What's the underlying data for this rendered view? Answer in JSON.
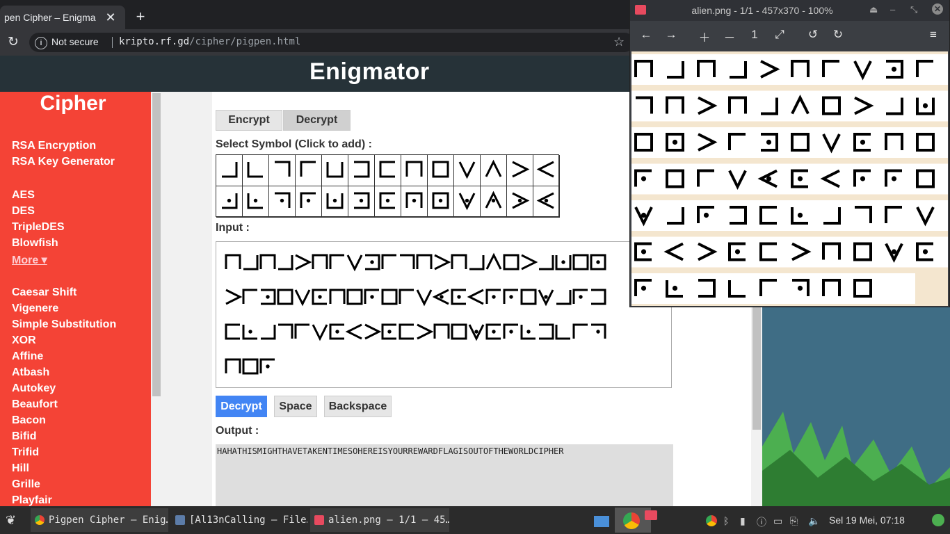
{
  "browser": {
    "tab_title": "pen Cipher – Enigma",
    "new_tab": "+",
    "close_glyph": "✕",
    "reload_glyph": "↻",
    "not_secure": "Not secure",
    "url_host": "kripto.rf.gd",
    "url_path": "/cipher/pigpen.html",
    "star_glyph": "☆"
  },
  "site": {
    "title": "Enigmator"
  },
  "sidebar": {
    "title": "Cipher",
    "items": [
      "RSA Encryption",
      "RSA Key Generator",
      "AES",
      "DES",
      "TripleDES",
      "Blowfish",
      "More ▾",
      "Caesar Shift",
      "Vigenere",
      "Simple Substitution",
      "XOR",
      "Affine",
      "Atbash",
      "Autokey",
      "Beaufort",
      "Bacon",
      "Bifid",
      "Trifid",
      "Hill",
      "Grille",
      "Playfair"
    ]
  },
  "main": {
    "tab_encrypt": "Encrypt",
    "tab_decrypt": "Decrypt",
    "select_label": "Select Symbol (Click to add) :",
    "input_label": "Input :",
    "btn_decrypt": "Decrypt",
    "btn_space": "Space",
    "btn_backspace": "Backspace",
    "output_label": "Output :",
    "output_text": "HAHATHISMIGHTHAVETAKENTIMESOHEREISYOURREWARDFLAGISOUTOFTHEWORLDCIPHER"
  },
  "viewer": {
    "title": "alien.png - 1/1 - 457x370 - 100%",
    "toolbar": [
      "←",
      "→",
      "＋",
      "－",
      "1",
      "⤢",
      "↺",
      "↻",
      "≡"
    ],
    "window_controls": [
      "⏏",
      "–",
      "⤡"
    ],
    "close_glyph": "✕"
  },
  "taskbar": {
    "task1": "Pigpen Cipher – Enig…",
    "task2": "[Al13nCalling – File…",
    "task3": "alien.png – 1/1 – 45…",
    "clock": "Sel 19 Mei, 07:18"
  },
  "colors": {
    "sidebar": "#f44336",
    "header": "#263238",
    "primary_button": "#4285f4"
  }
}
